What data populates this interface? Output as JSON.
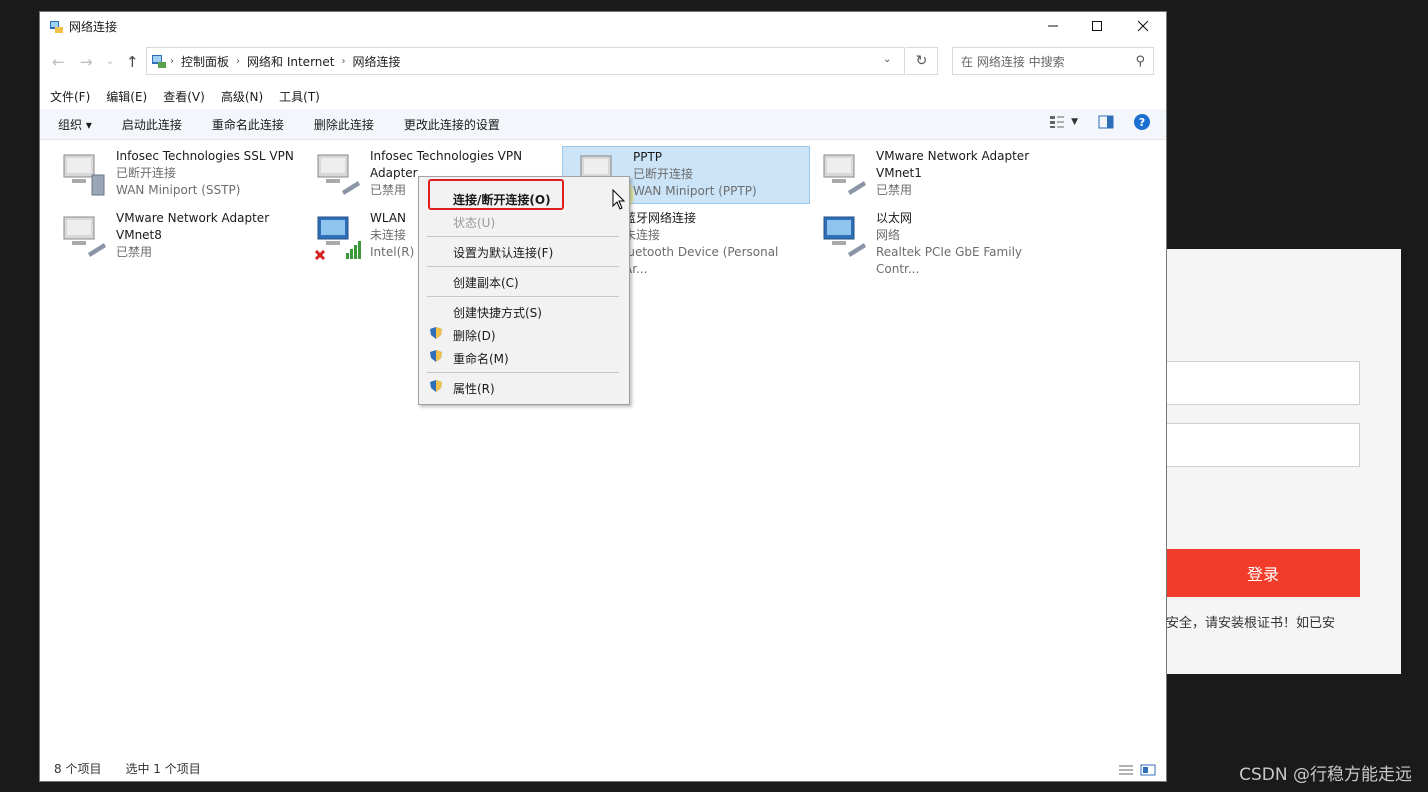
{
  "window": {
    "title": "网络连接"
  },
  "address": {
    "crumbs": [
      "控制面板",
      "网络和 Internet",
      "网络连接"
    ],
    "search_placeholder": "在 网络连接 中搜索"
  },
  "menubar": [
    "文件(F)",
    "编辑(E)",
    "查看(V)",
    "高级(N)",
    "工具(T)"
  ],
  "commandbar": [
    "组织 ▾",
    "启动此连接",
    "重命名此连接",
    "删除此连接",
    "更改此连接的设置"
  ],
  "connections": [
    {
      "name": "Infosec Technologies SSL VPN",
      "status": "已断开连接",
      "device": "WAN Miniport (SSTP)"
    },
    {
      "name": "Infosec Technologies VPN",
      "name2": "Adapter",
      "status": "已禁用"
    },
    {
      "name": "PPTP",
      "status": "已断开连接",
      "device": "WAN Miniport (PPTP)",
      "selected": true
    },
    {
      "name": "VMware Network Adapter",
      "name2": "VMnet1",
      "status": "已禁用"
    },
    {
      "name": "VMware Network Adapter",
      "name2": "VMnet8",
      "status": "已禁用"
    },
    {
      "name": "WLAN",
      "status": "未连接",
      "device": "Intel(R) W"
    },
    {
      "name": "蓝牙网络连接",
      "status": "未连接",
      "device": "luetooth Device (Personal Ar..."
    },
    {
      "name": "以太网",
      "status": "网络",
      "device": "Realtek PCIe GbE Family Contr..."
    }
  ],
  "context_menu": {
    "items": [
      "连接/断开连接(O)",
      "状态(U)",
      "设置为默认连接(F)",
      "创建副本(C)",
      "创建快捷方式(S)",
      "删除(D)",
      "重命名(M)",
      "属性(R)"
    ]
  },
  "statusbar": {
    "count": "8 个项目",
    "selected": "选中 1 个项目"
  },
  "background": {
    "login_button": "登录",
    "note": "安全，请安装根证书！如已安"
  },
  "watermark": "CSDN @行稳方能走远",
  "colors": {
    "selection": "#cce4f7",
    "highlight_box": "#e02020",
    "login": "#f03c28",
    "help": "#1a6fd1"
  }
}
